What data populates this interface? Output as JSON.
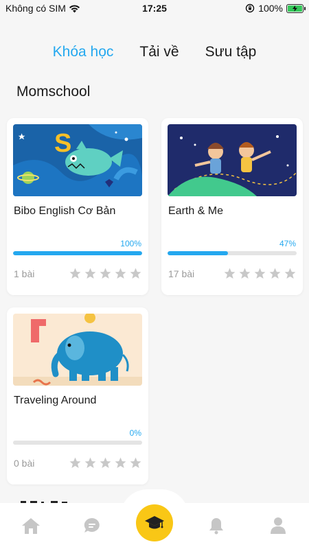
{
  "status_bar": {
    "carrier": "Không có SIM",
    "time": "17:25",
    "battery": "100%"
  },
  "tabs": [
    {
      "label": "Khóa học",
      "active": true
    },
    {
      "label": "Tải về",
      "active": false
    },
    {
      "label": "Sưu tập",
      "active": false
    }
  ],
  "section": {
    "title": "Momschool"
  },
  "courses": [
    {
      "title": "Bibo English Cơ Bản",
      "progress_label": "100%",
      "progress": 1.0,
      "lessons": "1 bài",
      "rating": 0
    },
    {
      "title": "Earth & Me",
      "progress_label": "47%",
      "progress": 0.47,
      "lessons": "17 bài",
      "rating": 0
    },
    {
      "title": "Traveling Around",
      "progress_label": "0%",
      "progress": 0.0,
      "lessons": "0 bài",
      "rating": 0
    }
  ],
  "colors": {
    "accent": "#24a8ef",
    "center_button": "#f9c716",
    "star": "#c8c8c8"
  },
  "nav": [
    {
      "icon": "home-icon"
    },
    {
      "icon": "chat-icon"
    },
    {
      "icon": "graduation-cap-icon",
      "active": true
    },
    {
      "icon": "bell-icon"
    },
    {
      "icon": "user-icon"
    }
  ]
}
